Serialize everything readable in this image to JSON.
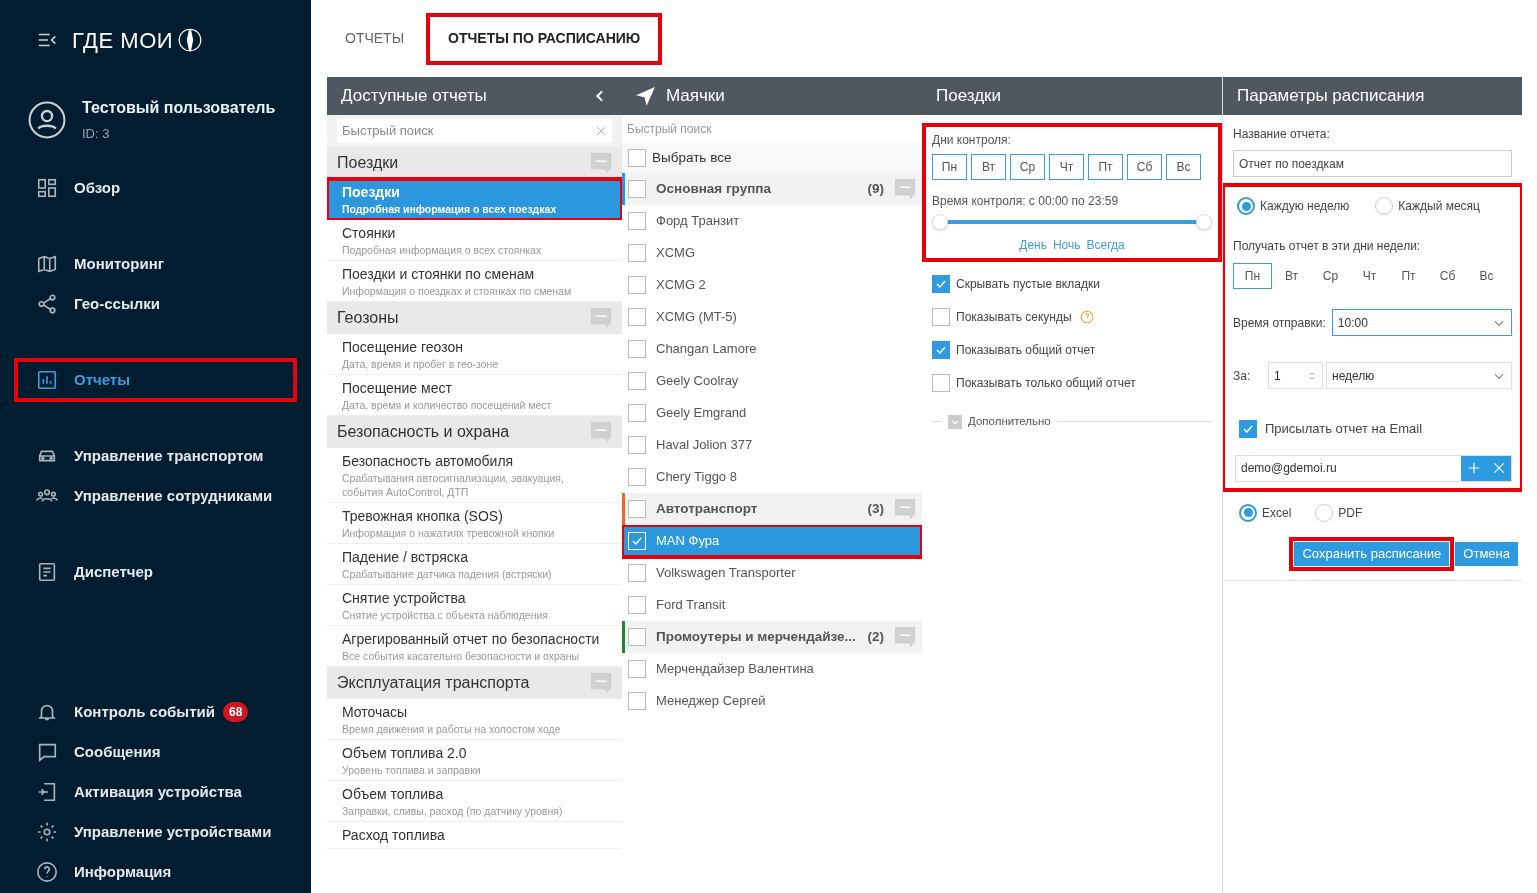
{
  "sidebar": {
    "logo": "ГДЕ МОИ",
    "user": {
      "name": "Тестовый пользователь",
      "id": "ID: 3"
    },
    "groups": [
      [
        {
          "label": "Обзор",
          "selected": false,
          "highlighted": false
        }
      ],
      [
        {
          "label": "Мониторинг",
          "selected": false,
          "highlighted": false
        },
        {
          "label": "Гео-ссылки",
          "selected": false,
          "highlighted": false
        }
      ],
      [
        {
          "label": "Отчеты",
          "selected": true,
          "highlighted": true
        }
      ],
      [
        {
          "label": "Управление транспортом",
          "selected": false,
          "highlighted": false
        },
        {
          "label": "Управление сотрудниками",
          "selected": false,
          "highlighted": false
        }
      ],
      [
        {
          "label": "Диспетчер",
          "selected": false,
          "highlighted": false
        }
      ]
    ],
    "bottom": [
      {
        "label": "Контроль событий",
        "badge": "68",
        "selected": false
      },
      {
        "label": "Сообщения",
        "selected": false
      },
      {
        "label": "Активация устройства",
        "selected": false
      },
      {
        "label": "Управление устройствами",
        "selected": false
      },
      {
        "label": "Информация",
        "selected": false
      }
    ]
  },
  "tabs": [
    {
      "label": "ОТЧЕТЫ",
      "selected": false,
      "highlighted": false
    },
    {
      "label": "ОТЧЕТЫ ПО РАСПИСАНИЮ",
      "selected": true,
      "highlighted": true
    }
  ],
  "reports": {
    "title": "Доступные отчеты",
    "search": {
      "placeholder": "Быстрый поиск"
    },
    "groups": [
      {
        "title": "Поездки",
        "items": [
          {
            "title": "Поездки",
            "subtitle": "Подробная информация о всех поездках",
            "selected": true,
            "highlighted": true
          },
          {
            "title": "Стоянки",
            "subtitle": "Подробная информация о всех стоянках",
            "selected": false,
            "highlighted": false
          },
          {
            "title": "Поездки и стоянки по сменам",
            "subtitle": "Информация о поездках и стоянках по сменам",
            "selected": false,
            "highlighted": false
          }
        ]
      },
      {
        "title": "Геозоны",
        "items": [
          {
            "title": "Посещение геозон",
            "subtitle": "Дата, время и пробег в гео-зоне",
            "selected": false,
            "highlighted": false
          },
          {
            "title": "Посещение мест",
            "subtitle": "Дата, время и количество посещений мест",
            "selected": false,
            "highlighted": false
          }
        ]
      },
      {
        "title": "Безопасность и охрана",
        "items": [
          {
            "title": "Безопасность автомобиля",
            "subtitle": "Срабатывания автосигнализации, эвакуация, события AutoControl, ДТП",
            "selected": false,
            "highlighted": false
          },
          {
            "title": "Тревожная кнопка (SOS)",
            "subtitle": "Информация о нажатиях тревожной кнопки",
            "selected": false,
            "highlighted": false
          },
          {
            "title": "Падение / встряска",
            "subtitle": "Срабатывание датчика падения (встряски)",
            "selected": false,
            "highlighted": false
          },
          {
            "title": "Снятие устройства",
            "subtitle": "Снятие устройства с объекта наблюдения",
            "selected": false,
            "highlighted": false
          },
          {
            "title": "Агрегированный отчет по безопасности",
            "subtitle": "Все события касательно безопасности и охраны",
            "selected": false,
            "highlighted": false
          }
        ]
      },
      {
        "title": "Эксплуатация транспорта",
        "items": [
          {
            "title": "Моточасы",
            "subtitle": "Время движения и работы на холостом ходе",
            "selected": false,
            "highlighted": false
          },
          {
            "title": "Объем топлива 2.0",
            "subtitle": "Уровень топлива и заправки",
            "selected": false,
            "highlighted": false
          },
          {
            "title": "Объем топлива",
            "subtitle": "Заправки, сливы, расход (по датчику уровня)",
            "selected": false,
            "highlighted": false
          },
          {
            "title": "Расход топлива",
            "selected": false,
            "highlighted": false
          }
        ]
      }
    ]
  },
  "trackers": {
    "title": "Маячки",
    "search": {
      "placeholder": "Быстрый поиск"
    },
    "select_all": {
      "label": "Выбрать все",
      "checked": false
    },
    "groups": [
      {
        "name": "Основная группа",
        "count": "(9)",
        "color": "#2196f3",
        "checked": false,
        "items": [
          {
            "name": "Форд Транзит",
            "checked": false,
            "selected": false,
            "highlighted": false
          },
          {
            "name": "XCMG",
            "checked": false,
            "selected": false,
            "highlighted": false
          },
          {
            "name": "XCMG 2",
            "checked": false,
            "selected": false,
            "highlighted": false
          },
          {
            "name": "XCMG (MT-5)",
            "checked": false,
            "selected": false,
            "highlighted": false
          },
          {
            "name": "Changan Lamore",
            "checked": false,
            "selected": false,
            "highlighted": false
          },
          {
            "name": "Geely Coolray",
            "checked": false,
            "selected": false,
            "highlighted": false
          },
          {
            "name": "Geely Emgrand",
            "checked": false,
            "selected": false,
            "highlighted": false
          },
          {
            "name": "Haval Jolion 377",
            "checked": false,
            "selected": false,
            "highlighted": false
          },
          {
            "name": "Chery Tiggo 8",
            "checked": false,
            "selected": false,
            "highlighted": false
          }
        ]
      },
      {
        "name": "Автотранспорт",
        "count": "(3)",
        "color": "#f26522",
        "checked": false,
        "items": [
          {
            "name": "MAN Фура",
            "checked": true,
            "selected": true,
            "highlighted": true
          },
          {
            "name": "Volkswagen Transporter",
            "checked": false,
            "selected": false,
            "highlighted": false
          },
          {
            "name": "Ford Transit",
            "checked": false,
            "selected": false,
            "highlighted": false
          }
        ]
      },
      {
        "name": "Промоутеры и мерчендайзе...",
        "count": "(2)",
        "color": "#1b8a2e",
        "checked": false,
        "items": [
          {
            "name": "Мерчендайзер Валентина",
            "checked": false,
            "selected": false,
            "highlighted": false
          },
          {
            "name": "Менеджер Сергей",
            "checked": false,
            "selected": false,
            "highlighted": false
          }
        ]
      }
    ]
  },
  "trip_settings": {
    "title": "Поездки",
    "control": {
      "highlighted": true,
      "days_label": "Дни контроля:",
      "days": [
        {
          "label": "Пн",
          "selected": false
        },
        {
          "label": "Вт",
          "selected": false
        },
        {
          "label": "Ср",
          "selected": false
        },
        {
          "label": "Чт",
          "selected": false
        },
        {
          "label": "Пт",
          "selected": false
        },
        {
          "label": "Сб",
          "selected": false
        },
        {
          "label": "Вс",
          "selected": false
        }
      ],
      "time_label": "Время контроля: с 00:00 по 23:59",
      "level": 1,
      "presets": [
        "День",
        "Ночь",
        "Всегда"
      ]
    },
    "options": [
      {
        "label": "Скрывать пустые вкладки",
        "checked": true,
        "help": false
      },
      {
        "label": "Показывать секунды",
        "checked": false,
        "help": true
      },
      {
        "label": "Показывать общий отчет",
        "checked": true,
        "help": false
      },
      {
        "label": "Показывать только общий отчет",
        "checked": false,
        "help": false
      }
    ],
    "more": {
      "label": "Дополнительно",
      "expanded": false
    }
  },
  "schedule": {
    "title": "Параметры расписания",
    "name_label": "Название отчета:",
    "name_value": "Отчет по поездкам",
    "highlighted": true,
    "periods": [
      {
        "label": "Каждую неделю",
        "selected": true
      },
      {
        "label": "Каждый месяц",
        "selected": false
      }
    ],
    "days_label": "Получать отчет в эти дни недели:",
    "days": [
      {
        "label": "Пн",
        "selected": true
      },
      {
        "label": "Вт",
        "selected": false
      },
      {
        "label": "Ср",
        "selected": false
      },
      {
        "label": "Чт",
        "selected": false
      },
      {
        "label": "Пт",
        "selected": false
      },
      {
        "label": "Сб",
        "selected": false
      },
      {
        "label": "Вс",
        "selected": false
      }
    ],
    "send_time_label": "Время отправки:",
    "send_time": "10:00",
    "for_label": "За:",
    "for_count": "1",
    "for_unit": "неделю",
    "email_toggle": {
      "label": "Присылать отчет на Email",
      "checked": true
    },
    "email": "demo@gdemoi.ru",
    "formats": [
      {
        "label": "Excel",
        "selected": true
      },
      {
        "label": "PDF",
        "selected": false
      }
    ],
    "save": {
      "label": "Сохранить расписание",
      "highlighted": true
    },
    "cancel": "Отмена"
  }
}
